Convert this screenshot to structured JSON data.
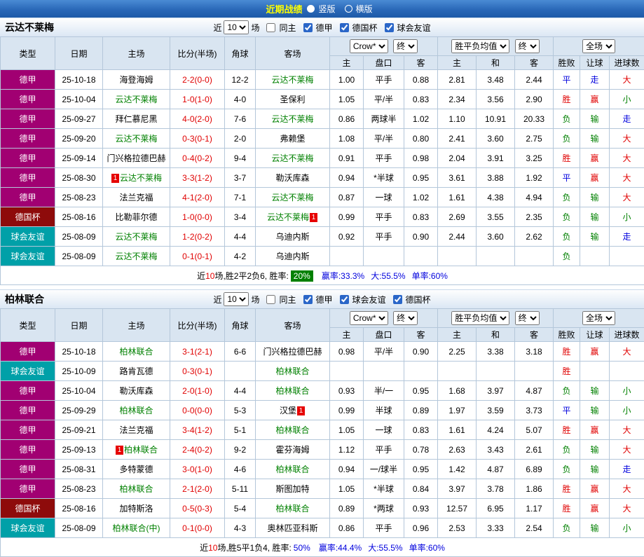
{
  "topbar": {
    "title": "近期战绩",
    "radios": [
      {
        "label": "竖版",
        "checked": true
      },
      {
        "label": "横版",
        "checked": false
      }
    ]
  },
  "sections": [
    {
      "team": "云达不莱梅",
      "filter": {
        "prefix": "近",
        "count": "10",
        "suffix": "场",
        "checkboxes": [
          {
            "label": "同主",
            "checked": false
          },
          {
            "label": "德甲",
            "checked": true
          },
          {
            "label": "德国杯",
            "checked": true
          },
          {
            "label": "球会友谊",
            "checked": true
          }
        ]
      },
      "header": {
        "type": "类型",
        "date": "日期",
        "home": "主场",
        "score": "比分(半场)",
        "corner": "角球",
        "away": "客场",
        "company": "Crow*",
        "final": "终",
        "avg": "胜平负均值",
        "final2": "终",
        "scope": "全场",
        "sub": [
          "主",
          "盘口",
          "客",
          "主",
          "和",
          "客",
          "胜败",
          "让球",
          "进球数"
        ]
      },
      "rows": [
        {
          "type": "德甲",
          "type_class": "league",
          "date": "25-10-18",
          "home": "海登海姆",
          "home_focus": false,
          "home_badge": "",
          "score": "2-2(0-0)",
          "corner": "12-2",
          "away": "云达不莱梅",
          "away_focus": true,
          "away_badge": "",
          "odds": [
            "1.00",
            "平手",
            "0.88"
          ],
          "avg": [
            "2.81",
            "3.48",
            "2.44"
          ],
          "res": [
            "平",
            "走",
            "大"
          ]
        },
        {
          "type": "德甲",
          "type_class": "league",
          "date": "25-10-04",
          "home": "云达不莱梅",
          "home_focus": true,
          "home_badge": "",
          "score": "1-0(1-0)",
          "corner": "4-0",
          "away": "圣保利",
          "away_focus": false,
          "away_badge": "",
          "odds": [
            "1.05",
            "平/半",
            "0.83"
          ],
          "avg": [
            "2.34",
            "3.56",
            "2.90"
          ],
          "res": [
            "胜",
            "赢",
            "小"
          ]
        },
        {
          "type": "德甲",
          "type_class": "league",
          "date": "25-09-27",
          "home": "拜仁慕尼黑",
          "home_focus": false,
          "home_badge": "",
          "score": "4-0(2-0)",
          "corner": "7-6",
          "away": "云达不莱梅",
          "away_focus": true,
          "away_badge": "",
          "odds": [
            "0.86",
            "两球半",
            "1.02"
          ],
          "avg": [
            "1.10",
            "10.91",
            "20.33"
          ],
          "res": [
            "负",
            "输",
            "走"
          ]
        },
        {
          "type": "德甲",
          "type_class": "league",
          "date": "25-09-20",
          "home": "云达不莱梅",
          "home_focus": true,
          "home_badge": "",
          "score": "0-3(0-1)",
          "corner": "2-0",
          "away": "弗赖堡",
          "away_focus": false,
          "away_badge": "",
          "odds": [
            "1.08",
            "平/半",
            "0.80"
          ],
          "avg": [
            "2.41",
            "3.60",
            "2.75"
          ],
          "res": [
            "负",
            "输",
            "大"
          ]
        },
        {
          "type": "德甲",
          "type_class": "league",
          "date": "25-09-14",
          "home": "门兴格拉德巴赫",
          "home_focus": false,
          "home_badge": "",
          "score": "0-4(0-2)",
          "corner": "9-4",
          "away": "云达不莱梅",
          "away_focus": true,
          "away_badge": "",
          "odds": [
            "0.91",
            "平手",
            "0.98"
          ],
          "avg": [
            "2.04",
            "3.91",
            "3.25"
          ],
          "res": [
            "胜",
            "赢",
            "大"
          ]
        },
        {
          "type": "德甲",
          "type_class": "league",
          "date": "25-08-30",
          "home": "云达不莱梅",
          "home_focus": true,
          "home_badge": "pre",
          "score": "3-3(1-2)",
          "corner": "3-7",
          "away": "勒沃库森",
          "away_focus": false,
          "away_badge": "",
          "odds": [
            "0.94",
            "*半球",
            "0.95"
          ],
          "avg": [
            "3.61",
            "3.88",
            "1.92"
          ],
          "res": [
            "平",
            "赢",
            "大"
          ]
        },
        {
          "type": "德甲",
          "type_class": "league",
          "date": "25-08-23",
          "home": "法兰克福",
          "home_focus": false,
          "home_badge": "",
          "score": "4-1(2-0)",
          "corner": "7-1",
          "away": "云达不莱梅",
          "away_focus": true,
          "away_badge": "",
          "odds": [
            "0.87",
            "一球",
            "1.02"
          ],
          "avg": [
            "1.61",
            "4.38",
            "4.94"
          ],
          "res": [
            "负",
            "输",
            "大"
          ]
        },
        {
          "type": "德国杯",
          "type_class": "cup",
          "date": "25-08-16",
          "home": "比勒菲尔德",
          "home_focus": false,
          "home_badge": "",
          "score": "1-0(0-0)",
          "corner": "3-4",
          "away": "云达不莱梅",
          "away_focus": true,
          "away_badge": "post",
          "odds": [
            "0.99",
            "平手",
            "0.83"
          ],
          "avg": [
            "2.69",
            "3.55",
            "2.35"
          ],
          "res": [
            "负",
            "输",
            "小"
          ]
        },
        {
          "type": "球会友谊",
          "type_class": "friendly",
          "date": "25-08-09",
          "home": "云达不莱梅",
          "home_focus": true,
          "home_badge": "",
          "score": "1-2(0-2)",
          "corner": "4-4",
          "away": "乌迪内斯",
          "away_focus": false,
          "away_badge": "",
          "odds": [
            "0.92",
            "平手",
            "0.90"
          ],
          "avg": [
            "2.44",
            "3.60",
            "2.62"
          ],
          "res": [
            "负",
            "输",
            "走"
          ]
        },
        {
          "type": "球会友谊",
          "type_class": "friendly",
          "date": "25-08-09",
          "home": "云达不莱梅",
          "home_focus": true,
          "home_badge": "",
          "score": "0-1(0-1)",
          "corner": "4-2",
          "away": "乌迪内斯",
          "away_focus": false,
          "away_badge": "",
          "odds": [
            "",
            "",
            ""
          ],
          "avg": [
            "",
            "",
            ""
          ],
          "res": [
            "负",
            "",
            ""
          ]
        }
      ],
      "summary": {
        "lead": "近",
        "count": "10",
        "tail": "场,胜2平2负6, 胜率:",
        "rate": "20%",
        "stats": [
          "赢率:33.3%",
          "大:55.5%",
          "单率:60%"
        ]
      }
    },
    {
      "team": "柏林联合",
      "filter": {
        "prefix": "近",
        "count": "10",
        "suffix": "场",
        "checkboxes": [
          {
            "label": "同主",
            "checked": false
          },
          {
            "label": "德甲",
            "checked": true
          },
          {
            "label": "球会友谊",
            "checked": true
          },
          {
            "label": "德国杯",
            "checked": true
          }
        ]
      },
      "header": {
        "type": "类型",
        "date": "日期",
        "home": "主场",
        "score": "比分(半场)",
        "corner": "角球",
        "away": "客场",
        "company": "Crow*",
        "final": "终",
        "avg": "胜平负均值",
        "final2": "终",
        "scope": "全场",
        "sub": [
          "主",
          "盘口",
          "客",
          "主",
          "和",
          "客",
          "胜败",
          "让球",
          "进球数"
        ]
      },
      "rows": [
        {
          "type": "德甲",
          "type_class": "league",
          "date": "25-10-18",
          "home": "柏林联合",
          "home_focus": true,
          "home_badge": "",
          "score": "3-1(2-1)",
          "corner": "6-6",
          "away": "门兴格拉德巴赫",
          "away_focus": false,
          "away_badge": "",
          "odds": [
            "0.98",
            "平/半",
            "0.90"
          ],
          "avg": [
            "2.25",
            "3.38",
            "3.18"
          ],
          "res": [
            "胜",
            "赢",
            "大"
          ]
        },
        {
          "type": "球会友谊",
          "type_class": "friendly",
          "date": "25-10-09",
          "home": "路肯瓦德",
          "home_focus": false,
          "home_badge": "",
          "score": "0-3(0-1)",
          "corner": "",
          "away": "柏林联合",
          "away_focus": true,
          "away_badge": "",
          "odds": [
            "",
            "",
            ""
          ],
          "avg": [
            "",
            "",
            ""
          ],
          "res": [
            "胜",
            "",
            ""
          ]
        },
        {
          "type": "德甲",
          "type_class": "league",
          "date": "25-10-04",
          "home": "勒沃库森",
          "home_focus": false,
          "home_badge": "",
          "score": "2-0(1-0)",
          "corner": "4-4",
          "away": "柏林联合",
          "away_focus": true,
          "away_badge": "",
          "odds": [
            "0.93",
            "半/一",
            "0.95"
          ],
          "avg": [
            "1.68",
            "3.97",
            "4.87"
          ],
          "res": [
            "负",
            "输",
            "小"
          ]
        },
        {
          "type": "德甲",
          "type_class": "league",
          "date": "25-09-29",
          "home": "柏林联合",
          "home_focus": true,
          "home_badge": "",
          "score": "0-0(0-0)",
          "corner": "5-3",
          "away": "汉堡",
          "away_focus": false,
          "away_badge": "post",
          "odds": [
            "0.99",
            "半球",
            "0.89"
          ],
          "avg": [
            "1.97",
            "3.59",
            "3.73"
          ],
          "res": [
            "平",
            "输",
            "小"
          ]
        },
        {
          "type": "德甲",
          "type_class": "league",
          "date": "25-09-21",
          "home": "法兰克福",
          "home_focus": false,
          "home_badge": "",
          "score": "3-4(1-2)",
          "corner": "5-1",
          "away": "柏林联合",
          "away_focus": true,
          "away_badge": "",
          "odds": [
            "1.05",
            "一球",
            "0.83"
          ],
          "avg": [
            "1.61",
            "4.24",
            "5.07"
          ],
          "res": [
            "胜",
            "赢",
            "大"
          ]
        },
        {
          "type": "德甲",
          "type_class": "league",
          "date": "25-09-13",
          "home": "柏林联合",
          "home_focus": true,
          "home_badge": "pre",
          "score": "2-4(0-2)",
          "corner": "9-2",
          "away": "霍芬海姆",
          "away_focus": false,
          "away_badge": "",
          "odds": [
            "1.12",
            "平手",
            "0.78"
          ],
          "avg": [
            "2.63",
            "3.43",
            "2.61"
          ],
          "res": [
            "负",
            "输",
            "大"
          ]
        },
        {
          "type": "德甲",
          "type_class": "league",
          "date": "25-08-31",
          "home": "多特蒙德",
          "home_focus": false,
          "home_badge": "",
          "score": "3-0(1-0)",
          "corner": "4-6",
          "away": "柏林联合",
          "away_focus": true,
          "away_badge": "",
          "odds": [
            "0.94",
            "一/球半",
            "0.95"
          ],
          "avg": [
            "1.42",
            "4.87",
            "6.89"
          ],
          "res": [
            "负",
            "输",
            "走"
          ]
        },
        {
          "type": "德甲",
          "type_class": "league",
          "date": "25-08-23",
          "home": "柏林联合",
          "home_focus": true,
          "home_badge": "",
          "score": "2-1(2-0)",
          "corner": "5-11",
          "away": "斯图加特",
          "away_focus": false,
          "away_badge": "",
          "odds": [
            "1.05",
            "*半球",
            "0.84"
          ],
          "avg": [
            "3.97",
            "3.78",
            "1.86"
          ],
          "res": [
            "胜",
            "赢",
            "大"
          ]
        },
        {
          "type": "德国杯",
          "type_class": "cup",
          "date": "25-08-16",
          "home": "加特斯洛",
          "home_focus": false,
          "home_badge": "",
          "score": "0-5(0-3)",
          "corner": "5-4",
          "away": "柏林联合",
          "away_focus": true,
          "away_badge": "",
          "odds": [
            "0.89",
            "*两球",
            "0.93"
          ],
          "avg": [
            "12.57",
            "6.95",
            "1.17"
          ],
          "res": [
            "胜",
            "赢",
            "大"
          ]
        },
        {
          "type": "球会友谊",
          "type_class": "friendly",
          "date": "25-08-09",
          "home": "柏林联合(中)",
          "home_focus": true,
          "home_badge": "",
          "score": "0-1(0-0)",
          "corner": "4-3",
          "away": "奥林匹亚科斯",
          "away_focus": false,
          "away_badge": "",
          "odds": [
            "0.86",
            "平手",
            "0.96"
          ],
          "avg": [
            "2.53",
            "3.33",
            "2.54"
          ],
          "res": [
            "负",
            "输",
            "小"
          ]
        }
      ],
      "summary": {
        "lead": "近",
        "count": "10",
        "tail": "场,胜5平1负4, 胜率:",
        "rate": "50%",
        "stats": [
          "赢率:44.4%",
          "大:55.5%",
          "单率:60%"
        ]
      }
    }
  ]
}
